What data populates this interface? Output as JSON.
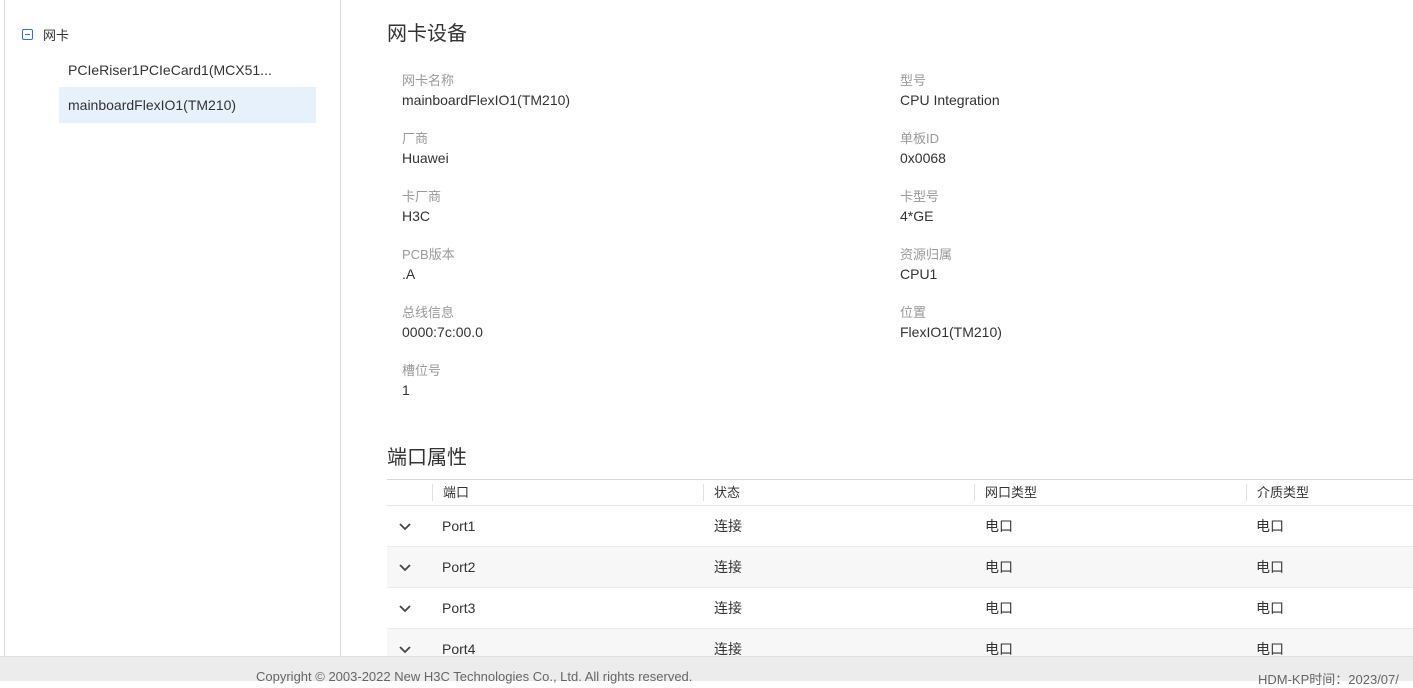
{
  "sidebar": {
    "root_label": "网卡",
    "items": [
      {
        "label": "PCIeRiser1PCIeCard1(MCX51..."
      },
      {
        "label": "mainboardFlexIO1(TM210)"
      }
    ]
  },
  "device": {
    "title": "网卡设备",
    "fields": [
      {
        "label": "网卡名称",
        "value": "mainboardFlexIO1(TM210)"
      },
      {
        "label": "型号",
        "value": "CPU Integration"
      },
      {
        "label": "厂商",
        "value": "Huawei"
      },
      {
        "label": "单板ID",
        "value": "0x0068"
      },
      {
        "label": "卡厂商",
        "value": "H3C"
      },
      {
        "label": "卡型号",
        "value": "4*GE"
      },
      {
        "label": "PCB版本",
        "value": ".A"
      },
      {
        "label": "资源归属",
        "value": "CPU1"
      },
      {
        "label": "总线信息",
        "value": "0000:7c:00.0"
      },
      {
        "label": "位置",
        "value": "FlexIO1(TM210)"
      },
      {
        "label": "槽位号",
        "value": "1"
      }
    ]
  },
  "ports": {
    "title": "端口属性",
    "columns": [
      "端口",
      "状态",
      "网口类型",
      "介质类型"
    ],
    "rows": [
      {
        "port": "Port1",
        "status": "连接",
        "type": "电口",
        "media": "电口"
      },
      {
        "port": "Port2",
        "status": "连接",
        "type": "电口",
        "media": "电口"
      },
      {
        "port": "Port3",
        "status": "连接",
        "type": "电口",
        "media": "电口"
      },
      {
        "port": "Port4",
        "status": "连接",
        "type": "电口",
        "media": "电口"
      }
    ]
  },
  "footer": {
    "copyright": "Copyright © 2003-2022 New H3C Technologies Co., Ltd. All rights reserved.",
    "time": "HDM-KP时间：2023/07/"
  },
  "colors": {
    "accent": "#2f6fd6",
    "selected_bg": "#e6f1fc"
  }
}
